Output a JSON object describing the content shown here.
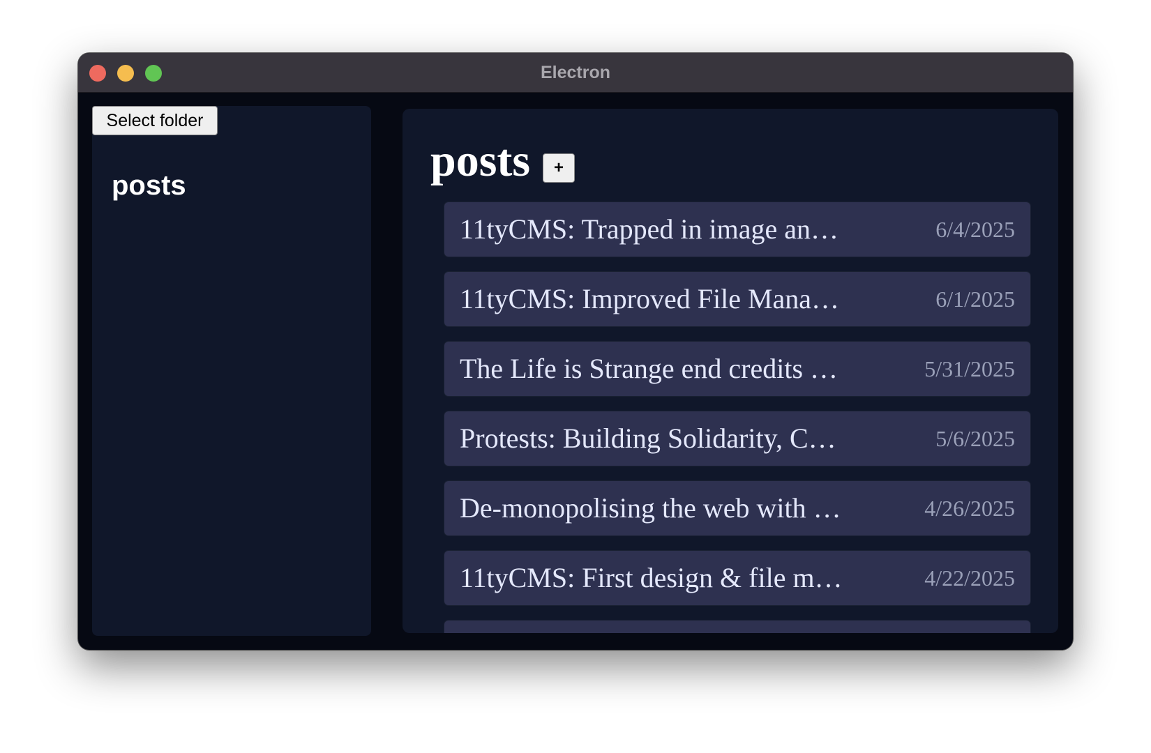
{
  "window": {
    "title": "Electron"
  },
  "sidebar": {
    "select_folder_label": "Select folder",
    "items": [
      {
        "label": "posts"
      }
    ]
  },
  "main": {
    "title": "posts",
    "add_label": "+",
    "posts": [
      {
        "title": "11tyCMS: Trapped in image an…",
        "date": "6/4/2025"
      },
      {
        "title": "11tyCMS: Improved File Mana…",
        "date": "6/1/2025"
      },
      {
        "title": "The Life is Strange end credits …",
        "date": "5/31/2025"
      },
      {
        "title": "Protests: Building Solidarity, C…",
        "date": "5/6/2025"
      },
      {
        "title": "De-monopolising the web with …",
        "date": "4/26/2025"
      },
      {
        "title": "11tyCMS: First design & file m…",
        "date": "4/22/2025"
      },
      {
        "title": "",
        "date": ""
      }
    ]
  },
  "colors": {
    "titlebar": "#38353d",
    "window_bg": "#060913",
    "panel_bg": "#10172a",
    "post_bg": "#2e3150",
    "close": "#ee6a5f",
    "minimize": "#f5bd4f",
    "maximize": "#61c554"
  }
}
